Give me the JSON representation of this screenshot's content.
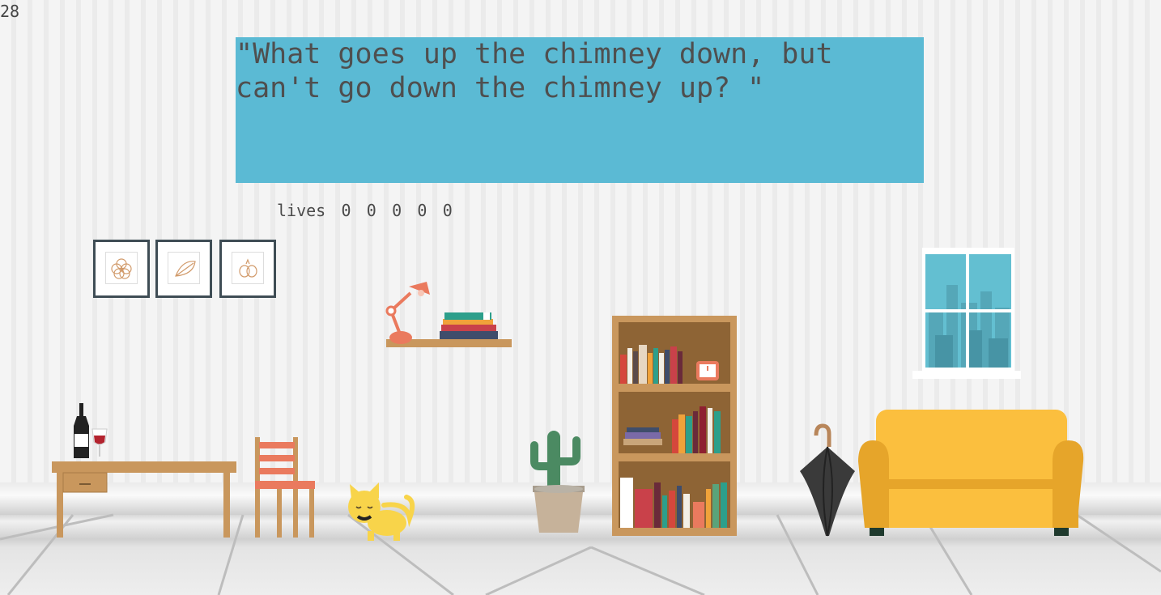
{
  "game": {
    "counter": "28",
    "riddle": "\"What goes up the chimney down, but can't go down the chimney up? \"",
    "lives_label": "lives",
    "lives": [
      "0",
      "0",
      "0",
      "0",
      "0"
    ]
  },
  "colors": {
    "riddle_box": "#5bbad4",
    "sofa": "#fbbf3e",
    "cat": "#f8d44a",
    "lamp": "#ea7a5e",
    "wood": "#c9975d"
  },
  "scene_objects": [
    "picture-frames",
    "desk-lamp",
    "wall-shelf",
    "bookshelf",
    "window",
    "desk",
    "wine-bottle",
    "wine-glass",
    "chair",
    "cat",
    "cactus",
    "umbrella",
    "sofa"
  ]
}
